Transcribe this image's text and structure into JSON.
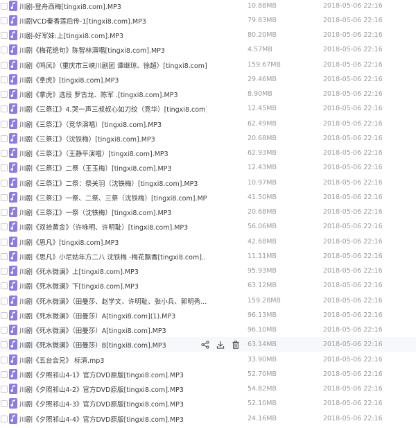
{
  "colors": {
    "file_icon": "#8d7ae6",
    "text": "#3b3b3b",
    "meta": "#9a9a9a",
    "hover_row": "#f6f8fb"
  },
  "file_icon_name": "music-file-icon",
  "files": [
    {
      "name": "川剧-登舟西梅[tingxi8.com].MP3",
      "size": "10.88MB",
      "date": "2018-05-06 22:16"
    },
    {
      "name": "川剧VCD秦香莲后传-1[tingxi8.com].MP3",
      "size": "79.83MB",
      "date": "2018-05-06 22:16"
    },
    {
      "name": "川剧-好军妹:上[tingxi8.com].MP3",
      "size": "80.20MB",
      "date": "2018-05-06 22:16"
    },
    {
      "name": "川剧《梅花绝句》陈智林演唱[tingxi8.com].MP3",
      "size": "4.57MB",
      "date": "2018-05-06 22:16"
    },
    {
      "name": "川剧《鸣凤》（重庆市三峡川剧团 谭继琼、徐超）[tingxi8.com]...",
      "size": "159.67MB",
      "date": "2018-05-06 22:16"
    },
    {
      "name": "川剧《拿虎》[tingxi8.com].MP3",
      "size": "29.46MB",
      "date": "2018-05-06 22:16"
    },
    {
      "name": "川剧《拿虎》选段 罗古龙、陈军 .[tingxi8.com].MP3",
      "size": "8.90MB",
      "date": "2018-05-06 22:16"
    },
    {
      "name": "川剧《三祭江》4.哭一声三叔叔心如刀绞（竞华）[tingxi8.com]...",
      "size": "12.45MB",
      "date": "2018-05-06 22:16"
    },
    {
      "name": "川剧《三祭江》（竞华演唱）[tingxi8.com].MP3",
      "size": "62.49MB",
      "date": "2018-05-06 22:16"
    },
    {
      "name": "川剧《三祭江》（沈铁梅）[tingxi8.com].MP3",
      "size": "20.68MB",
      "date": "2018-05-06 22:16"
    },
    {
      "name": "川剧《三祭江》（王静平演唱）[tingxi8.com].MP3",
      "size": "62.93MB",
      "date": "2018-05-06 22:16"
    },
    {
      "name": "川剧《三祭江》二祭（王玉梅）[tingxi8.com].MP3",
      "size": "12.43MB",
      "date": "2018-05-06 22:16"
    },
    {
      "name": "川剧《三祭江》二祭：祭关羽（沈铁梅）[tingxi8.com].MP3",
      "size": "10.97MB",
      "date": "2018-05-06 22:16"
    },
    {
      "name": "川剧《三祭江》一祭、二祭、三祭（沈铁梅）[tingxi8.com].MP3",
      "size": "41.50MB",
      "date": "2018-05-06 22:16"
    },
    {
      "name": "川剧《三祭江》一祭（沈铁梅）[tingxi8.com].MP3",
      "size": "20.68MB",
      "date": "2018-05-06 22:16"
    },
    {
      "name": "川剧《双拾黄金》（许咏明、许明耻）[tingxi8.com].MP3",
      "size": "56.06MB",
      "date": "2018-05-06 22:16"
    },
    {
      "name": "川剧《思凡》[tingxi8.com].MP3",
      "size": "42.68MB",
      "date": "2018-05-06 22:16"
    },
    {
      "name": "川剧《思凡》小尼姑年方二八 沈铁梅 -梅花飘香[tingxi8.com]....",
      "size": "11.11MB",
      "date": "2018-05-06 22:16"
    },
    {
      "name": "川剧《死水微澜》上[tingxi8.com].MP3",
      "size": "95.93MB",
      "date": "2018-05-06 22:16"
    },
    {
      "name": "川剧《死水微澜》下[tingxi8.com].MP3",
      "size": "63.12MB",
      "date": "2018-05-06 22:16"
    },
    {
      "name": "川剧《死水微澜》（田曼莎、赵学文、许明耻、张小兵、郭明秀...",
      "size": "159.28MB",
      "date": "2018-05-06 22:16"
    },
    {
      "name": "川剧《死水微澜》（田曼莎）A[tingxi8.com](1).MP3",
      "size": "96.13MB",
      "date": "2018-05-06 22:16"
    },
    {
      "name": "川剧《死水微澜》（田曼莎）A[tingxi8.com].MP3",
      "size": "96.10MB",
      "date": "2018-05-06 22:16"
    },
    {
      "name": "川剧《死水微澜》（田曼莎）B[tingxi8.com].MP3",
      "size": "63.14MB",
      "date": "2018-05-06 22:16"
    },
    {
      "name": "川剧《五台会兄》 标清.mp3",
      "size": "33.90MB",
      "date": "2018-05-06 22:16"
    },
    {
      "name": "川剧《夕照祁山4-1》官方DVD原版[tingxi8.com].MP3",
      "size": "52.70MB",
      "date": "2018-05-06 22:16"
    },
    {
      "name": "川剧《夕照祁山4-2》官方DVD原版[tingxi8.com].MP3",
      "size": "54.82MB",
      "date": "2018-05-06 22:16"
    },
    {
      "name": "川剧《夕照祁山4-3》官方DVD原版[tingxi8.com].MP3",
      "size": "52.10MB",
      "date": "2018-05-06 22:16"
    },
    {
      "name": "川剧《夕照祁山4-4》官方DVD原版[tingxi8.com].MP3",
      "size": "24.16MB",
      "date": "2018-05-06 22:16"
    }
  ],
  "hover_actions": [
    "share-icon",
    "download-icon",
    "delete-icon"
  ]
}
